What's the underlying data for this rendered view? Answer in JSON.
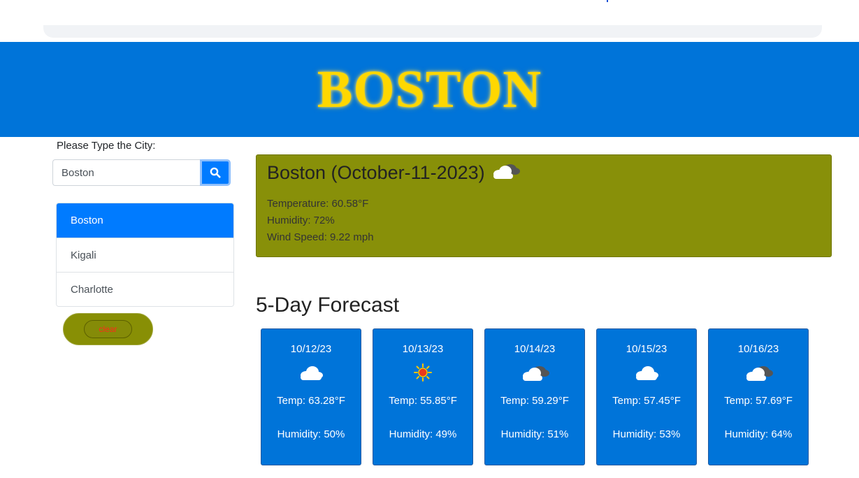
{
  "banner": {
    "title": "BOSTON"
  },
  "search": {
    "label": "Please Type the City:",
    "value": "Boston",
    "button_icon": "search-icon"
  },
  "history": {
    "items": [
      {
        "label": "Boston",
        "active": true
      },
      {
        "label": "Kigali",
        "active": false
      },
      {
        "label": "Charlotte",
        "active": false
      }
    ]
  },
  "clear_button": {
    "label": "clear"
  },
  "current": {
    "heading": "Boston (October-11-2023)",
    "icon": "partly-cloudy-icon",
    "temperature": "Temperature: 60.58°F",
    "humidity": "Humidity: 72%",
    "wind": "Wind Speed: 9.22 mph"
  },
  "forecast": {
    "title": "5-Day Forecast",
    "days": [
      {
        "date": "10/12/23",
        "icon": "cloud-icon",
        "temp": "Temp: 63.28°F",
        "humidity": "Humidity: 50%"
      },
      {
        "date": "10/13/23",
        "icon": "sun-icon",
        "temp": "Temp: 55.85°F",
        "humidity": "Humidity: 49%"
      },
      {
        "date": "10/14/23",
        "icon": "partly-cloudy-icon",
        "temp": "Temp: 59.29°F",
        "humidity": "Humidity: 51%"
      },
      {
        "date": "10/15/23",
        "icon": "cloud-icon",
        "temp": "Temp: 57.45°F",
        "humidity": "Humidity: 53%"
      },
      {
        "date": "10/16/23",
        "icon": "partly-cloudy-icon",
        "temp": "Temp: 57.69°F",
        "humidity": "Humidity: 64%"
      }
    ]
  },
  "colors": {
    "banner_bg": "#0074d9",
    "banner_text": "#ffd700",
    "accent": "#007bff",
    "olive": "#888f05",
    "clear_text": "#ff2a1a"
  }
}
